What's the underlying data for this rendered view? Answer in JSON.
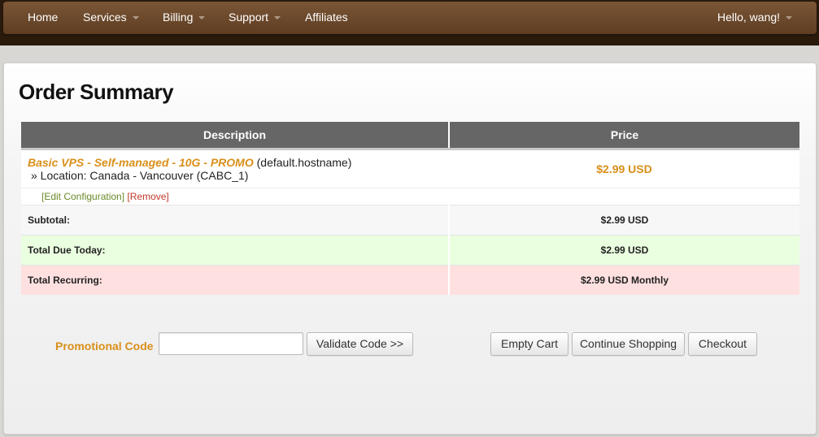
{
  "nav": {
    "home": "Home",
    "services": "Services",
    "billing": "Billing",
    "support": "Support",
    "affiliates": "Affiliates",
    "user_greeting": "Hello, wang!"
  },
  "page": {
    "title": "Order Summary"
  },
  "table": {
    "headers": {
      "description": "Description",
      "price": "Price"
    },
    "item": {
      "name": "Basic VPS - Self-managed - 10G - PROMO",
      "hostname": " (default.hostname)",
      "location": "» Location: Canada - Vancouver (CABC_1)",
      "price": "$2.99 USD",
      "edit_link": "[Edit Configuration]",
      "remove_link": "[Remove]"
    },
    "subtotal": {
      "label": "Subtotal:",
      "amount": "$2.99 USD"
    },
    "due_today": {
      "label": "Total Due Today:",
      "amount": "$2.99 USD"
    },
    "recurring": {
      "label": "Total Recurring:",
      "amount": "$2.99 USD Monthly"
    }
  },
  "promo": {
    "label": "Promotional Code",
    "input_value": "",
    "validate_button": "Validate Code >>"
  },
  "actions": {
    "empty_cart": "Empty Cart",
    "continue_shopping": "Continue Shopping",
    "checkout": "Checkout"
  },
  "colors": {
    "accent_orange": "#d98f1a",
    "nav_brown": "#6b4729",
    "due_today_bg": "#eaffdf",
    "recurring_bg": "#ffe0e0"
  }
}
